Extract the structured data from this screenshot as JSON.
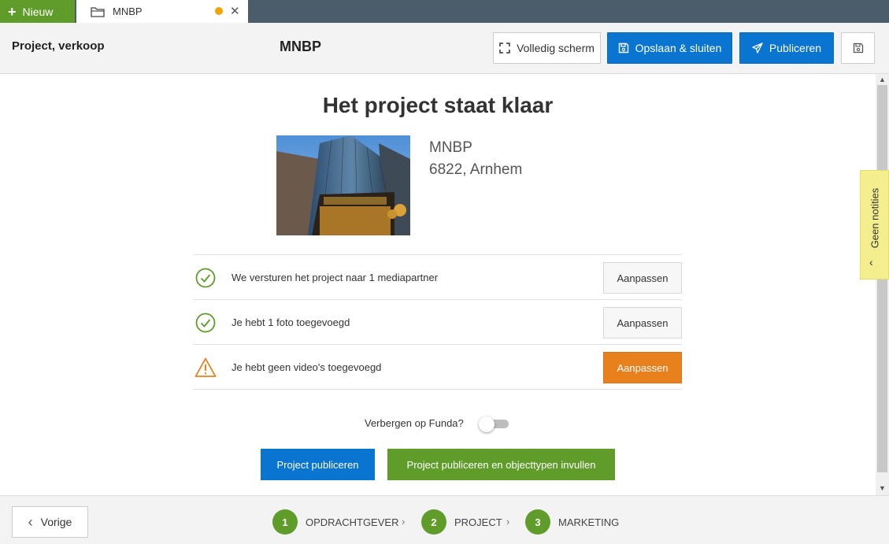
{
  "tabs": {
    "new_label": "Nieuw",
    "doc_tab_label": "MNBP"
  },
  "header": {
    "section": "Project, verkoop",
    "title": "MNBP",
    "fullscreen_label": "Volledig scherm",
    "save_close_label": "Opslaan & sluiten",
    "publish_label": "Publiceren"
  },
  "main": {
    "heading": "Het project staat klaar",
    "address_line1": "MNBP",
    "address_line2": "6822, Arnhem",
    "checklist": [
      {
        "text": "We versturen het project naar 1 mediapartner",
        "status": "ok",
        "button": "Aanpassen"
      },
      {
        "text": "Je hebt 1 foto toegevoegd",
        "status": "ok",
        "button": "Aanpassen"
      },
      {
        "text": "Je hebt geen video's toegevoegd",
        "status": "warning",
        "button": "Aanpassen"
      }
    ],
    "toggle_label": "Verbergen op Funda?",
    "toggle_on": false,
    "publish_project_label": "Project publiceren",
    "publish_objecttypes_label": "Project publiceren en objecttypen invullen"
  },
  "notes": {
    "label": "Geen notities"
  },
  "footer": {
    "prev_label": "Vorige",
    "steps": [
      {
        "num": "1",
        "label": "OPDRACHTGEVER"
      },
      {
        "num": "2",
        "label": "PROJECT"
      },
      {
        "num": "3",
        "label": "MARKETING"
      }
    ]
  },
  "colors": {
    "green": "#5f9c2a",
    "blue": "#0a74d1",
    "orange": "#e8801e",
    "notes_yellow": "#f5ee8f",
    "tabstrip": "#4b5d6b"
  }
}
